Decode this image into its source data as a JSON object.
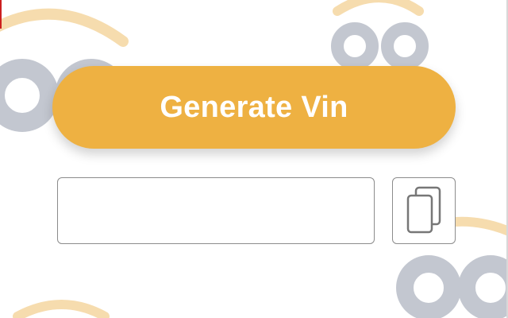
{
  "generate_button": {
    "label": "Generate Vin"
  },
  "vin_field": {
    "value": "",
    "placeholder": ""
  },
  "copy_button": {
    "icon": "copy-icon"
  },
  "colors": {
    "accent": "#eeb142",
    "decor_gray": "#c3c7d0",
    "decor_yellow": "#f6dcae",
    "field_border": "#8c8c8c"
  }
}
